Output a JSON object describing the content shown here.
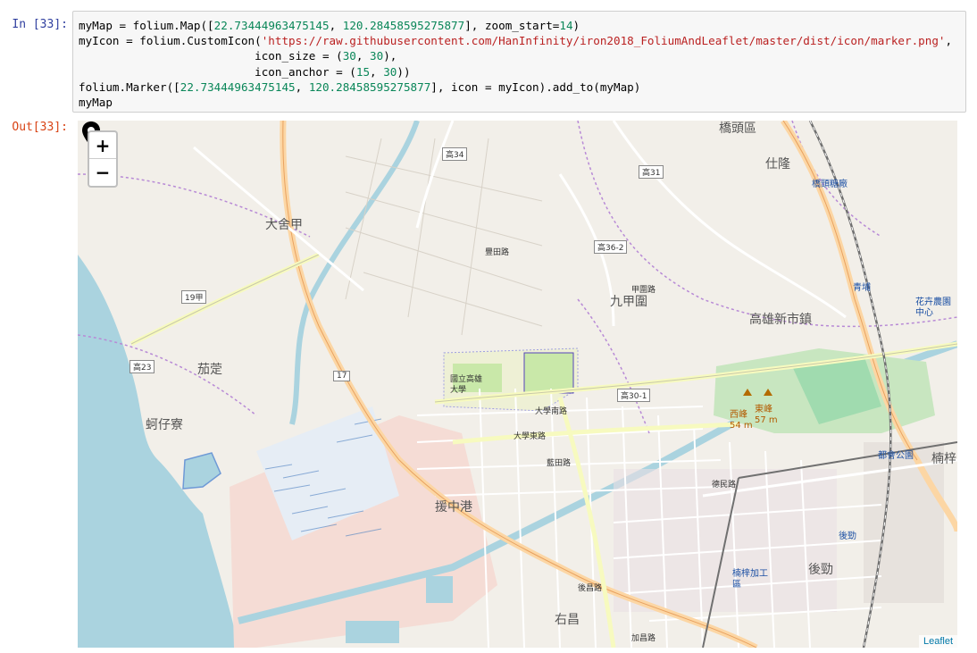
{
  "cell": {
    "in_prompt": "In [33]:",
    "out_prompt": "Out[33]:"
  },
  "code": {
    "line1_a": "myMap = folium.Map([",
    "line1_n1": "22.73444963475145",
    "line1_b": ", ",
    "line1_n2": "120.28458595275877",
    "line1_c": "], zoom_start=",
    "line1_n3": "14",
    "line1_d": ")",
    "line2_a": "myIcon = folium.CustomIcon(",
    "line2_s": "'https://raw.githubusercontent.com/HanInfinity/iron2018_FoliumAndLeaflet/master/dist/icon/marker.png'",
    "line2_b": ",",
    "line3_a": "                          icon_size = (",
    "line3_n1": "30",
    "line3_b": ", ",
    "line3_n2": "30",
    "line3_c": "),",
    "line4_a": "                          icon_anchor = (",
    "line4_n1": "15",
    "line4_b": ", ",
    "line4_n2": "30",
    "line4_c": "))",
    "line5_a": "folium.Marker([",
    "line5_n1": "22.73444963475145",
    "line5_b": ", ",
    "line5_n2": "120.28458595275877",
    "line5_c": "], icon = myIcon).add_to(myMap)",
    "line6": "myMap"
  },
  "map": {
    "zoom_in": "+",
    "zoom_out": "−",
    "attribution": "Leaflet",
    "labels": {
      "dashe": "大舍甲",
      "qiezhi": "茄萣",
      "kezaiiliao": "蚵仔寮",
      "nanzi": "國立高雄大學",
      "jiuchuan": "九甲圍",
      "gaoxiong_new": "高雄新市鎮",
      "renlong": "仕隆",
      "qiaotou": "橋頭區",
      "yuanzhong": "援中港",
      "houjin": "後勁",
      "youchang": "右昌",
      "nanzi_export": "楠梓加工區",
      "park": "都會公園",
      "nanzi2": "楠梓",
      "xifeng": "西峰 54 m",
      "dongfeng": "東峰 57 m",
      "qiaotou_sugar": "橋頭糖廠",
      "flower": "花卉農園中心",
      "qingpu": "青埔",
      "houjin_st": "後勁",
      "daxue_s": "大學南路",
      "daxue_e": "大學東路",
      "lantian": "藍田路",
      "dexmin": "德民路",
      "jiachang": "加昌路",
      "houchang": "後昌路",
      "fengtian": "豐田路",
      "jiachangw": "甲圍路"
    },
    "shields": {
      "r34": "高34",
      "r31": "高31",
      "r36_2": "高36-2",
      "r19": "19甲",
      "r23": "高23",
      "r17": "17",
      "r30_1": "高30-1"
    }
  }
}
